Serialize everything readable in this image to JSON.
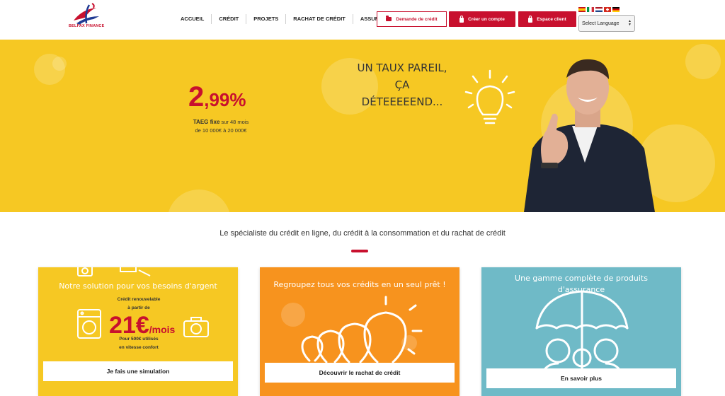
{
  "header": {
    "logo_text": "BELFAX FINANCE",
    "nav": [
      "ACCUEIL",
      "CRÉDIT",
      "PROJETS",
      "RACHAT DE CRÉDIT",
      "ASSURANCE"
    ],
    "btn_request": "Demande de crédit",
    "btn_account": "Créer un compte",
    "btn_client": "Espace client",
    "language_select": "Select Language",
    "flags": [
      "spain-flag-icon",
      "italy-flag-icon",
      "netherlands-flag-icon",
      "switzerland-flag-icon",
      "germany-flag-icon"
    ]
  },
  "hero": {
    "rate_int": "2",
    "rate_dec": ",99%",
    "taeg_bold": "TAEG fixe",
    "taeg_rest": " sur 48 mois",
    "taeg_range": "de 10 000€ à 20 000€",
    "tagline_1": "UN TAUX PAREIL,",
    "tagline_2": "ÇA DÉTEEEEEND..."
  },
  "subtitle": "Le spécialiste du crédit en ligne, du crédit à la consommation et du rachat de crédit",
  "cards": [
    {
      "title": "Notre solution pour vos besoins d'argent",
      "line1": "Crédit renouvelable",
      "line2": "à partir de",
      "price": "21€",
      "unit": "/mois",
      "line3": "Pour 500€ utilisés",
      "line4": "en vitesse confort",
      "button": "Je fais une simulation"
    },
    {
      "title": "Regroupez tous vos crédits en un seul prêt !",
      "button": "Découvrir le rachat de crédit"
    },
    {
      "title_1": "Une gamme complète de produits",
      "title_2": "d'assurance",
      "button": "En savoir plus"
    }
  ],
  "colors": {
    "brand_red": "#c8102e",
    "hero_yellow": "#f6c823",
    "card_orange": "#f7931e",
    "card_teal": "#6fbac7"
  }
}
